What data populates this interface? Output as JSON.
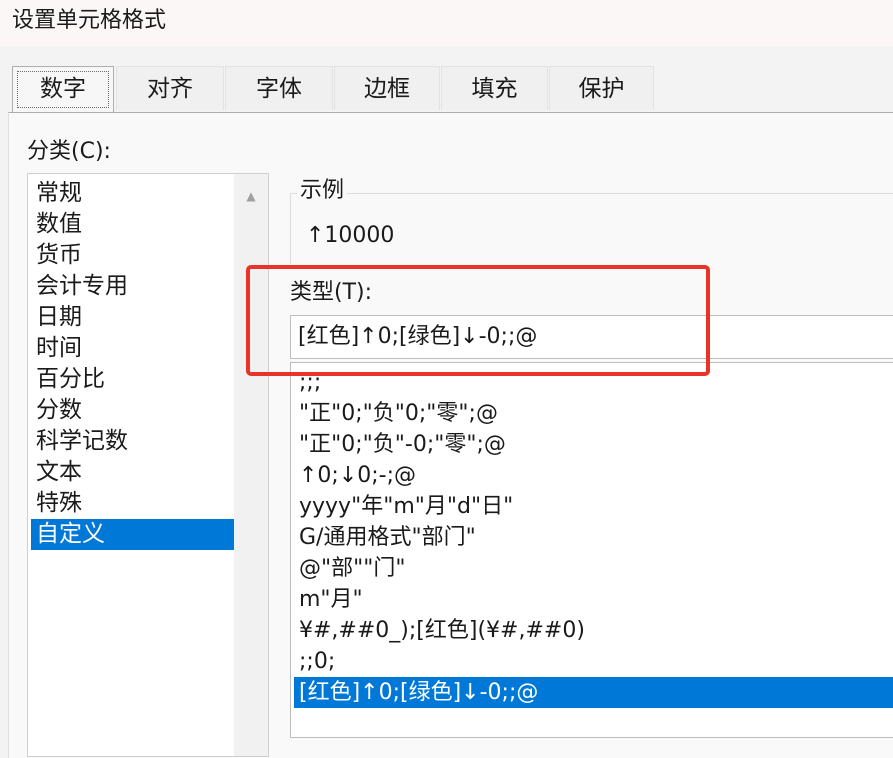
{
  "dialog": {
    "title": "设置单元格格式"
  },
  "tabs": [
    {
      "label": "数字",
      "active": true
    },
    {
      "label": "对齐"
    },
    {
      "label": "字体"
    },
    {
      "label": "边框"
    },
    {
      "label": "填充"
    },
    {
      "label": "保护"
    }
  ],
  "category": {
    "label": "分类(C):",
    "items": [
      "常规",
      "数值",
      "货币",
      "会计专用",
      "日期",
      "时间",
      "百分比",
      "分数",
      "科学记数",
      "文本",
      "特殊",
      "自定义"
    ],
    "selected": "自定义"
  },
  "sample": {
    "legend": "示例",
    "value": "↑10000"
  },
  "type": {
    "label": "类型(T):",
    "input_value": "[红色]↑0;[绿色]↓-0;;@",
    "items": [
      ";;;",
      "\"正\"0;\"负\"0;\"零\";@",
      "\"正\"0;\"负\"-0;\"零\";@",
      "↑0;↓0;-;@",
      "yyyy\"年\"m\"月\"d\"日\"",
      "G/通用格式\"部门\"",
      "@\"部\"\"门\"",
      "m\"月\"",
      "¥#,##0_);[红色](¥#,##0)",
      ";;0;",
      "[红色]↑0;[绿色]↓-0;;@"
    ],
    "selected": "[红色]↑0;[绿色]↓-0;;@"
  },
  "colors": {
    "selection": "#0078d7",
    "highlight": "#e8332a"
  }
}
